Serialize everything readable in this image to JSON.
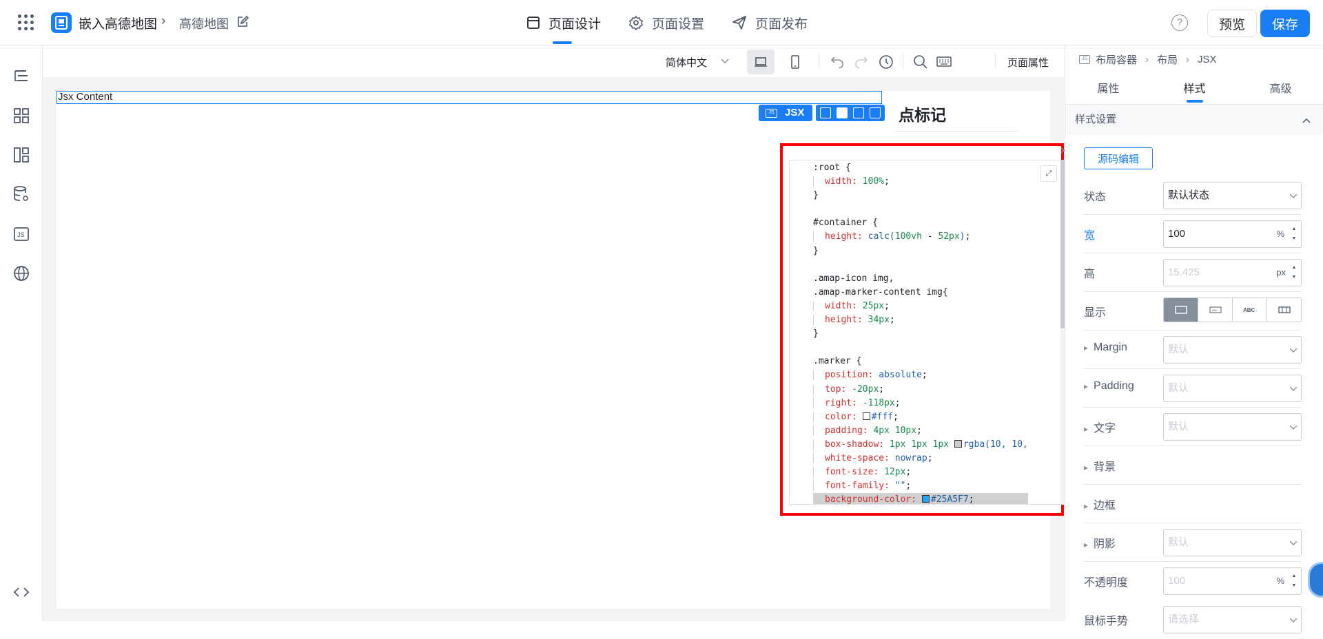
{
  "header": {
    "app_name": "嵌入高德地图",
    "page_name": "高德地图",
    "tabs": [
      {
        "label": "页面设计",
        "icon": "window-icon",
        "active": true
      },
      {
        "label": "页面设置",
        "icon": "gear-icon",
        "active": false
      },
      {
        "label": "页面发布",
        "icon": "send-icon",
        "active": false
      }
    ],
    "help_label": "?",
    "preview_label": "预览",
    "save_label": "保存",
    "accent": "#1a7ff6"
  },
  "toolbar": {
    "language": "简体中文",
    "page_props": "页面属性"
  },
  "canvas": {
    "jsx_content": "Jsx Content",
    "jsx_tag": "JSX",
    "map_title": "点标记"
  },
  "code_editor": {
    "lines": [
      {
        "indent": false,
        "parts": [
          [
            "sel",
            ":root {"
          ]
        ]
      },
      {
        "indent": true,
        "parts": [
          [
            "prop",
            "width: "
          ],
          [
            "valg",
            "100%"
          ],
          [
            "pun",
            ";"
          ]
        ]
      },
      {
        "indent": false,
        "parts": [
          [
            "pun",
            "}"
          ]
        ]
      },
      {
        "indent": false,
        "parts": [
          [
            "pun",
            ""
          ]
        ]
      },
      {
        "indent": false,
        "parts": [
          [
            "sel",
            "#container {"
          ]
        ]
      },
      {
        "indent": true,
        "parts": [
          [
            "prop",
            "height: "
          ],
          [
            "valb",
            "calc("
          ],
          [
            "valg",
            "100vh"
          ],
          [
            "pun",
            " - "
          ],
          [
            "valg",
            "52px"
          ],
          [
            "valb",
            ")"
          ],
          [
            "pun",
            ";"
          ]
        ]
      },
      {
        "indent": false,
        "parts": [
          [
            "pun",
            "}"
          ]
        ]
      },
      {
        "indent": false,
        "parts": [
          [
            "pun",
            ""
          ]
        ]
      },
      {
        "indent": false,
        "parts": [
          [
            "sel",
            ".amap-icon img,"
          ]
        ]
      },
      {
        "indent": false,
        "parts": [
          [
            "sel",
            ".amap-marker-content img{"
          ]
        ]
      },
      {
        "indent": true,
        "parts": [
          [
            "prop",
            "width: "
          ],
          [
            "valg",
            "25px"
          ],
          [
            "pun",
            ";"
          ]
        ]
      },
      {
        "indent": true,
        "parts": [
          [
            "prop",
            "height: "
          ],
          [
            "valg",
            "34px"
          ],
          [
            "pun",
            ";"
          ]
        ]
      },
      {
        "indent": false,
        "parts": [
          [
            "pun",
            "}"
          ]
        ]
      },
      {
        "indent": false,
        "parts": [
          [
            "pun",
            ""
          ]
        ]
      },
      {
        "indent": false,
        "parts": [
          [
            "sel",
            ".marker {"
          ]
        ]
      },
      {
        "indent": true,
        "parts": [
          [
            "prop",
            "position: "
          ],
          [
            "valb",
            "absolute"
          ],
          [
            "pun",
            ";"
          ]
        ]
      },
      {
        "indent": true,
        "parts": [
          [
            "prop",
            "top: "
          ],
          [
            "valg",
            "-20px"
          ],
          [
            "pun",
            ";"
          ]
        ]
      },
      {
        "indent": true,
        "parts": [
          [
            "prop",
            "right: "
          ],
          [
            "valg",
            "-118px"
          ],
          [
            "pun",
            ";"
          ]
        ]
      },
      {
        "indent": true,
        "swatch": "#ffffff",
        "parts": [
          [
            "prop",
            "color: "
          ],
          [
            "valb",
            "#fff"
          ],
          [
            "pun",
            ";"
          ]
        ]
      },
      {
        "indent": true,
        "parts": [
          [
            "prop",
            "padding: "
          ],
          [
            "valg",
            "4px 10px"
          ],
          [
            "pun",
            ";"
          ]
        ]
      },
      {
        "indent": true,
        "swatch": "#cccccc",
        "parts": [
          [
            "prop",
            "box-shadow: "
          ],
          [
            "valg",
            "1px 1px 1px "
          ],
          [
            "valb",
            "rgba(10, 10,"
          ]
        ]
      },
      {
        "indent": true,
        "parts": [
          [
            "prop",
            "white-space: "
          ],
          [
            "valb",
            "nowrap"
          ],
          [
            "pun",
            ";"
          ]
        ]
      },
      {
        "indent": true,
        "parts": [
          [
            "prop",
            "font-size: "
          ],
          [
            "valg",
            "12px"
          ],
          [
            "pun",
            ";"
          ]
        ]
      },
      {
        "indent": true,
        "parts": [
          [
            "prop",
            "font-family: "
          ],
          [
            "valb",
            "\"\""
          ],
          [
            "pun",
            ";"
          ]
        ]
      },
      {
        "indent": true,
        "current": true,
        "swatch": "#25A5F7",
        "parts": [
          [
            "prop",
            "background-color: "
          ],
          [
            "valb",
            "#25A5F7"
          ],
          [
            "pun",
            ";"
          ]
        ]
      }
    ],
    "scroll_fraction": 0.49
  },
  "right_panel": {
    "breadcrumb": [
      "布局容器",
      "布局",
      "JSX"
    ],
    "breadcrumb_icon": "JS",
    "tabs": [
      {
        "label": "属性",
        "active": false
      },
      {
        "label": "样式",
        "active": true
      },
      {
        "label": "高级",
        "active": false
      }
    ],
    "section_title": "样式设置",
    "source_edit": "源码编辑",
    "state_label": "状态",
    "state_value": "默认状态",
    "width_label": "宽",
    "width_value": "100",
    "width_unit": "%",
    "height_label": "高",
    "height_placeholder": "15.425",
    "height_unit": "px",
    "display_label": "显示",
    "display_options": [
      "block",
      "ABC",
      "ABC",
      "inline-block"
    ],
    "margin_label": "Margin",
    "padding_label": "Padding",
    "text_label": "文字",
    "default_placeholder": "默认",
    "bg_label": "背景",
    "border_label": "边框",
    "shadow_label": "阴影",
    "opacity_label": "不透明度",
    "opacity_placeholder": "100",
    "opacity_unit": "%",
    "cursor_label": "鼠标手势",
    "cursor_placeholder": "请选择"
  }
}
